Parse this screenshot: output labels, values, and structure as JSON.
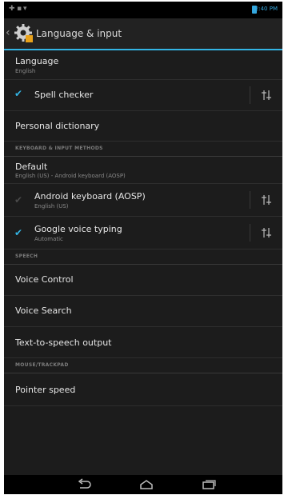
{
  "status_bar": {
    "left_icons": [
      "✚",
      "▪",
      "▾"
    ],
    "clock": "2:40 PM"
  },
  "action_bar": {
    "title": "Language & input"
  },
  "items": {
    "language": {
      "title": "Language",
      "summary": "English"
    },
    "spell_checker": {
      "title": "Spell checker",
      "checked": true
    },
    "personal_dictionary": {
      "title": "Personal dictionary"
    },
    "keyboard_section": "KEYBOARD & INPUT METHODS",
    "default": {
      "title": "Default",
      "summary": "English (US) - Android keyboard (AOSP)"
    },
    "android_keyboard": {
      "title": "Android keyboard (AOSP)",
      "summary": "English (US)",
      "checked": false
    },
    "google_voice": {
      "title": "Google voice typing",
      "summary": "Automatic",
      "checked": true
    },
    "speech_section": "SPEECH",
    "voice_control": {
      "title": "Voice Control"
    },
    "voice_search": {
      "title": "Voice Search"
    },
    "tts": {
      "title": "Text-to-speech output"
    },
    "mouse_section": "MOUSE/TRACKPAD",
    "pointer_speed": {
      "title": "Pointer speed"
    }
  },
  "icons": {
    "settings": "settings-gear-icon",
    "tune": "tune-sliders-icon",
    "back": "back-icon",
    "home": "home-icon",
    "recents": "recent-apps-icon"
  },
  "colors": {
    "accent": "#33b5e5",
    "background": "#1c1c1c"
  }
}
